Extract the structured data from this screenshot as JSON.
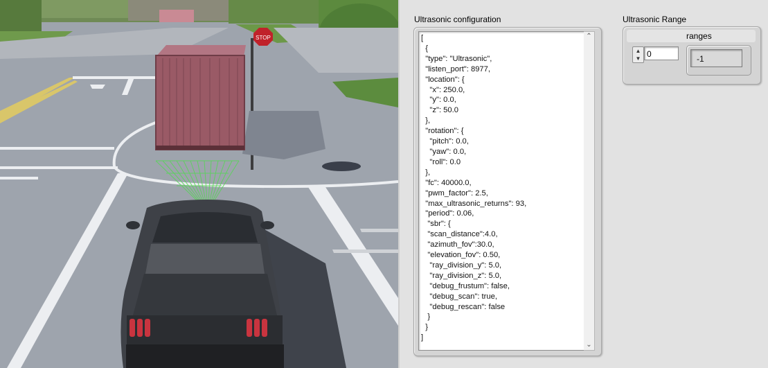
{
  "config_panel": {
    "title": "Ultrasonic configuration",
    "json_text": "[\n  {\n  \"type\": \"Ultrasonic\",\n  \"listen_port\": 8977,\n  \"location\": {\n    \"x\": 250.0,\n    \"y\": 0.0,\n    \"z\": 50.0\n  },\n  \"rotation\": {\n    \"pitch\": 0.0,\n    \"yaw\": 0.0,\n    \"roll\": 0.0\n  },\n  \"fc\": 40000.0,\n  \"pwm_factor\": 2.5,\n  \"max_ultrasonic_returns\": 93,\n  \"period\": 0.06,\n   \"sbr\": {\n   \"scan_distance\":4.0,\n   \"azimuth_fov\":30.0,\n   \"elevation_fov\": 0.50,\n    \"ray_division_y\": 5.0,\n    \"ray_division_z\": 5.0,\n    \"debug_frustum\": false,\n    \"debug_scan\": true,\n    \"debug_rescan\": false\n   }\n  }\n]"
  },
  "range_panel": {
    "title": "Ultrasonic Range",
    "array_label": "ranges",
    "index_value": "0",
    "element_value": "-1"
  },
  "scene": {
    "stop_sign_text": "STOP",
    "colors": {
      "asphalt": "#9ea4ad",
      "container": "#9a5a66",
      "car_body": "#3e4147",
      "sensor_rays": "#5ad35a"
    }
  }
}
